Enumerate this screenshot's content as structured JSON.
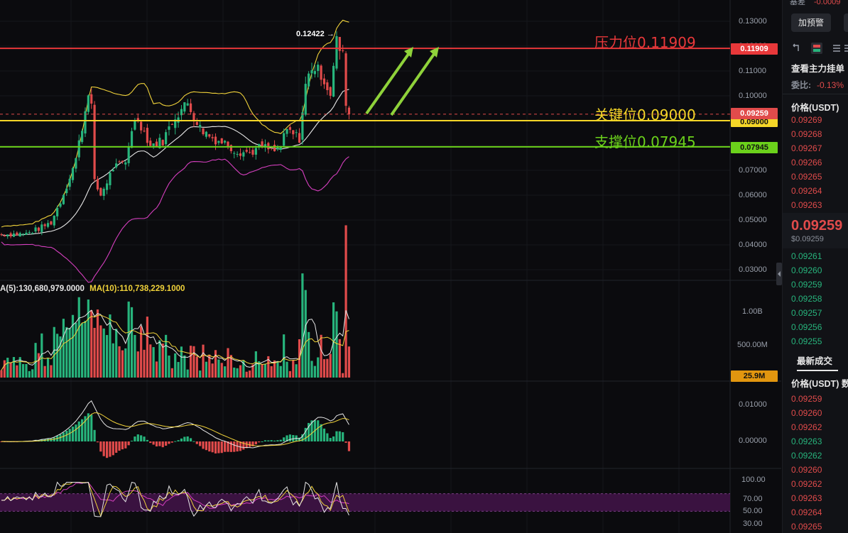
{
  "chart": {
    "peak_label": "0.12422",
    "resistance": {
      "label": "压力位0.11909",
      "value": 0.11909,
      "tag": "0.11909",
      "color": "#e8383a"
    },
    "key": {
      "label": "关键位0.09000",
      "value": 0.09,
      "tag": "0.09000",
      "color": "#f5d628"
    },
    "support": {
      "label": "支撑位0.07945",
      "value": 0.07945,
      "tag": "0.07945",
      "color": "#6bd11b"
    },
    "current_tag": "0.09259",
    "current_value": 0.09259,
    "price_ticks": [
      "0.13000",
      "0.12000",
      "0.11000",
      "0.10000",
      "0.09000",
      "0.08000",
      "0.07000",
      "0.06000",
      "0.05000",
      "0.04000",
      "0.03000"
    ],
    "price_tick_values": [
      0.13,
      0.12,
      0.11,
      0.1,
      0.09,
      0.08,
      0.07,
      0.06,
      0.05,
      0.04,
      0.03
    ],
    "volume_legend": {
      "ma5": "A(5):130,680,979.0000",
      "ma10": "MA(10):110,738,229.1000"
    },
    "volume_ticks": [
      "1.00B",
      "500.00M"
    ],
    "volume_tag": "25.9M",
    "macd_ticks": [
      "0.01000",
      "0.00000"
    ],
    "rsi_ticks": [
      "100.00",
      "70.00",
      "50.00",
      "30.00"
    ],
    "colors": {
      "up": "#27b47c",
      "down": "#e14b4b",
      "ma_white": "#e6e6e6",
      "ma_yellow": "#f0d23a",
      "boll_lower": "#d63fbf",
      "arrow": "#8fd23a",
      "rsi_band": "#3a1240"
    }
  },
  "panel": {
    "top_clip": "基差",
    "top_clip_value": "-0.0009",
    "alert_button": "加预警",
    "depth_title": "查看主力挂单",
    "ratio_label": "委比:",
    "ratio_value": "-0.13%",
    "orderbook_header": "价格(USDT)",
    "asks": [
      "0.09269",
      "0.09268",
      "0.09267",
      "0.09266",
      "0.09265",
      "0.09264",
      "0.09263"
    ],
    "last_price": "0.09259",
    "last_price_usd": "$0.09259",
    "bids": [
      "0.09261",
      "0.09260",
      "0.09259",
      "0.09258",
      "0.09257",
      "0.09256",
      "0.09255"
    ],
    "trades_title": "最新成交",
    "trades_header": "价格(USDT)  数",
    "trades": [
      {
        "price": "0.09259",
        "side": "sell"
      },
      {
        "price": "0.09260",
        "side": "sell"
      },
      {
        "price": "0.09262",
        "side": "sell"
      },
      {
        "price": "0.09263",
        "side": "buy"
      },
      {
        "price": "0.09262",
        "side": "buy"
      },
      {
        "price": "0.09260",
        "side": "sell"
      },
      {
        "price": "0.09262",
        "side": "sell"
      },
      {
        "price": "0.09263",
        "side": "sell"
      },
      {
        "price": "0.09264",
        "side": "sell"
      },
      {
        "price": "0.09265",
        "side": "sell"
      }
    ]
  }
}
